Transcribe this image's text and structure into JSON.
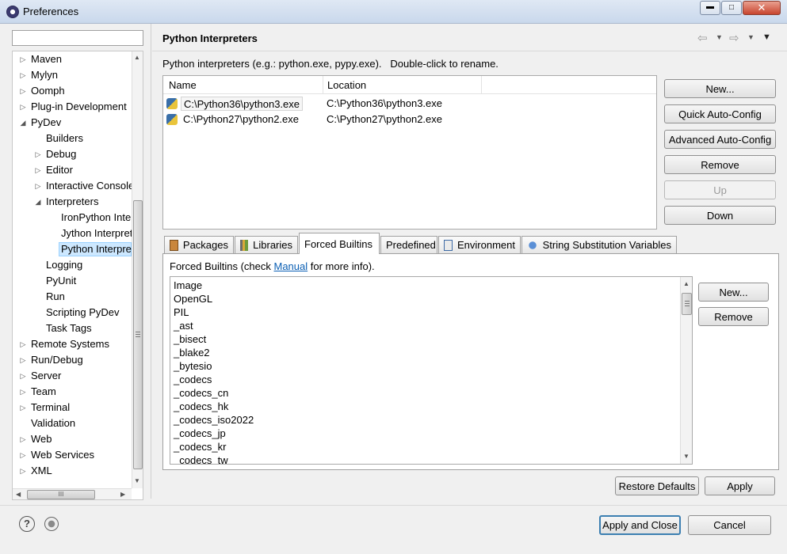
{
  "window": {
    "title": "Preferences"
  },
  "filter": {
    "placeholder": ""
  },
  "tree": {
    "items": [
      {
        "label": "Maven",
        "level": 0,
        "twisty": "closed"
      },
      {
        "label": "Mylyn",
        "level": 0,
        "twisty": "closed"
      },
      {
        "label": "Oomph",
        "level": 0,
        "twisty": "closed"
      },
      {
        "label": "Plug-in Development",
        "level": 0,
        "twisty": "closed"
      },
      {
        "label": "PyDev",
        "level": 0,
        "twisty": "open"
      },
      {
        "label": "Builders",
        "level": 1,
        "twisty": ""
      },
      {
        "label": "Debug",
        "level": 1,
        "twisty": "closed"
      },
      {
        "label": "Editor",
        "level": 1,
        "twisty": "closed"
      },
      {
        "label": "Interactive Console",
        "level": 1,
        "twisty": "closed"
      },
      {
        "label": "Interpreters",
        "level": 1,
        "twisty": "open"
      },
      {
        "label": "IronPython Interpreter",
        "level": 2,
        "twisty": ""
      },
      {
        "label": "Jython Interpreter",
        "level": 2,
        "twisty": ""
      },
      {
        "label": "Python Interpreter",
        "level": 2,
        "twisty": "",
        "selected": true
      },
      {
        "label": "Logging",
        "level": 1,
        "twisty": ""
      },
      {
        "label": "PyUnit",
        "level": 1,
        "twisty": ""
      },
      {
        "label": "Run",
        "level": 1,
        "twisty": ""
      },
      {
        "label": "Scripting PyDev",
        "level": 1,
        "twisty": ""
      },
      {
        "label": "Task Tags",
        "level": 1,
        "twisty": ""
      },
      {
        "label": "Remote Systems",
        "level": 0,
        "twisty": "closed"
      },
      {
        "label": "Run/Debug",
        "level": 0,
        "twisty": "closed"
      },
      {
        "label": "Server",
        "level": 0,
        "twisty": "closed"
      },
      {
        "label": "Team",
        "level": 0,
        "twisty": "closed"
      },
      {
        "label": "Terminal",
        "level": 0,
        "twisty": "closed"
      },
      {
        "label": "Validation",
        "level": 0,
        "twisty": ""
      },
      {
        "label": "Web",
        "level": 0,
        "twisty": "closed"
      },
      {
        "label": "Web Services",
        "level": 0,
        "twisty": "closed"
      },
      {
        "label": "XML",
        "level": 0,
        "twisty": "closed"
      }
    ],
    "hscroll_grip": "III"
  },
  "page": {
    "title": "Python Interpreters",
    "description": "Python interpreters (e.g.: python.exe, pypy.exe).   Double-click to rename.",
    "columns": [
      "Name",
      "Location"
    ],
    "interpreters": [
      {
        "name": "C:\\Python36\\python3.exe",
        "location": "C:\\Python36\\python3.exe"
      },
      {
        "name": "C:\\Python27\\python2.exe",
        "location": "C:\\Python27\\python2.exe"
      }
    ],
    "side_buttons": {
      "new": "New...",
      "quick": "Quick Auto-Config",
      "advanced": "Advanced Auto-Config",
      "remove": "Remove",
      "up": "Up",
      "down": "Down"
    },
    "tabs": [
      "Packages",
      "Libraries",
      "Forced Builtins",
      "Predefined",
      "Environment",
      "String Substitution Variables"
    ],
    "forced": {
      "prefix": "Forced Builtins (check ",
      "link": "Manual",
      "suffix": " for more info).",
      "items": [
        "Image",
        "OpenGL",
        "PIL",
        "_ast",
        "_bisect",
        "_blake2",
        "_bytesio",
        "_codecs",
        "_codecs_cn",
        "_codecs_hk",
        "_codecs_iso2022",
        "_codecs_jp",
        "_codecs_kr",
        "_codecs_tw"
      ],
      "new": "New...",
      "remove": "Remove"
    },
    "restore_defaults": "Restore Defaults",
    "apply": "Apply"
  },
  "footer": {
    "apply_close": "Apply and Close",
    "cancel": "Cancel"
  },
  "colors": {
    "selection": "#cde8ff",
    "link": "#0b5fb4"
  }
}
